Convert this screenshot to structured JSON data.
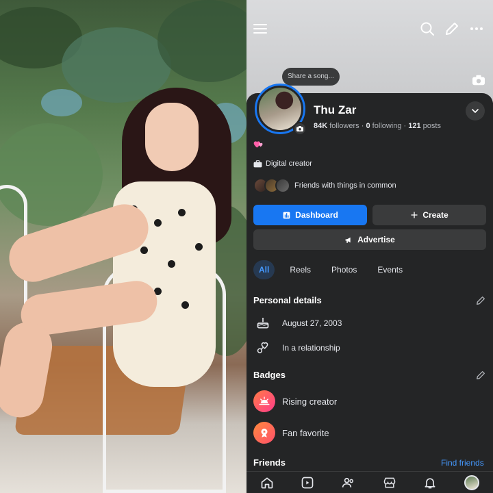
{
  "header": {
    "song_prompt": "Share a song..."
  },
  "profile": {
    "name": "Thu Zar",
    "followers_count": "84K",
    "followers_label": "followers",
    "following_count": "0",
    "following_label": "following",
    "posts_count": "121",
    "posts_label": "posts",
    "role": "Digital creator",
    "mutual_text": "Friends with things in common"
  },
  "actions": {
    "dashboard": "Dashboard",
    "create": "Create",
    "advertise": "Advertise"
  },
  "tabs": [
    "All",
    "Reels",
    "Photos",
    "Events"
  ],
  "personal_details": {
    "title": "Personal details",
    "birthday": "August 27, 2003",
    "relationship": "In a relationship"
  },
  "badges": {
    "title": "Badges",
    "items": [
      "Rising creator",
      "Fan favorite"
    ]
  },
  "friends": {
    "title": "Friends",
    "link": "Find friends"
  },
  "colors": {
    "accent": "#1877f2",
    "background": "#242526",
    "button": "#3a3b3c",
    "link": "#4599ff"
  },
  "icons": [
    "menu-icon",
    "search-icon",
    "edit-icon",
    "more-icon",
    "camera-icon",
    "chevron-down-icon",
    "dashboard-icon",
    "plus-icon",
    "megaphone-icon",
    "cake-icon",
    "heart-icon",
    "pencil-icon",
    "sunrise-icon",
    "star-badge-icon",
    "home-icon",
    "reels-icon",
    "friends-icon",
    "marketplace-icon",
    "bell-icon"
  ]
}
